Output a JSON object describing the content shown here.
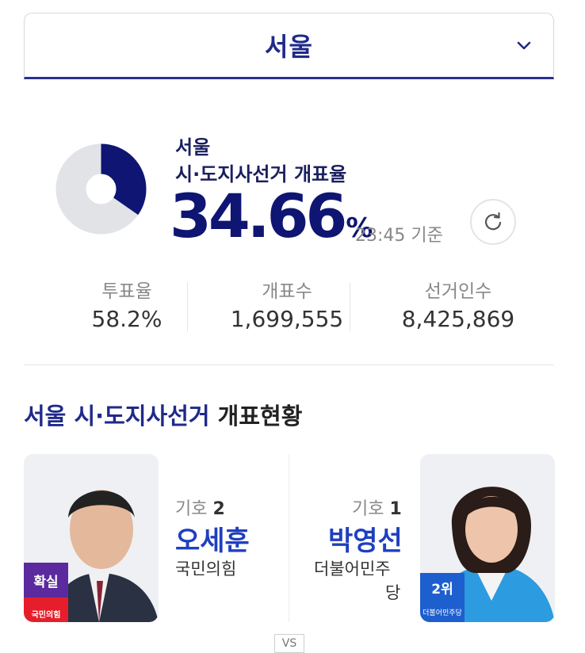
{
  "region_selector": {
    "value": "서울"
  },
  "summary": {
    "region": "서울",
    "election": "시·도지사선거 개표율",
    "count_rate": "34.66",
    "percent_sign": "%",
    "as_of": "23:45 기준",
    "count_rate_fraction": 0.3466
  },
  "stats": [
    {
      "label": "투표율",
      "value": "58.2%"
    },
    {
      "label": "개표수",
      "value": "1,699,555"
    },
    {
      "label": "선거인수",
      "value": "8,425,869"
    }
  ],
  "section": {
    "title_blue": "서울 시·도지사선거",
    "title_dark": "개표현황"
  },
  "candidates": [
    {
      "number_label": "기호",
      "number": "2",
      "name": "오세훈",
      "party": "국민의힘",
      "status_badge": "확실",
      "party_logo_text": "국민의힘"
    },
    {
      "number_label": "기호",
      "number": "1",
      "name": "박영선",
      "party_line1": "더불어민주",
      "party_line2": "당",
      "rank_badge": "2위",
      "party_logo_text": "더불어민주당"
    }
  ],
  "vs_label": "VS",
  "colors": {
    "accent": "#1f2a8a",
    "donut_fill": "#0f1572",
    "donut_track": "#e1e3e6",
    "confirm_badge": "#5b2a9e",
    "ppp_red": "#e61e2b",
    "dp_blue": "#1e5fcf"
  },
  "icons": [
    "chevron-down-icon",
    "refresh-icon"
  ]
}
